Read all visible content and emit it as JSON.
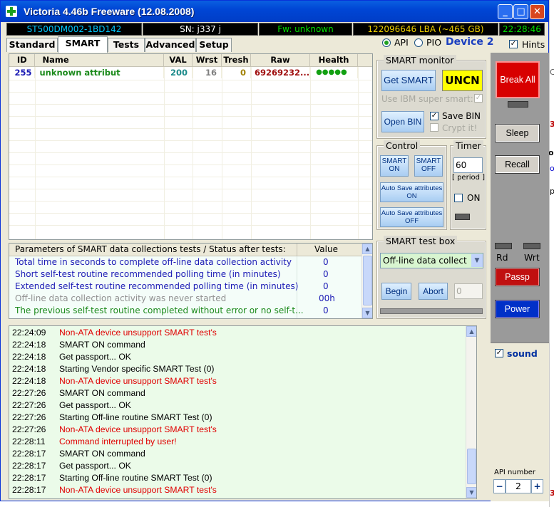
{
  "window": {
    "title": "Victoria 4.46b Freeware (12.08.2008)"
  },
  "status_bar": {
    "model": "ST500DM002-1BD142",
    "serial": "SN: j337         j",
    "firmware": "Fw: unknown",
    "capacity": "122096646 LBA (~465 GB)",
    "clock": "22:28:46"
  },
  "tabs": [
    "Standard",
    "SMART",
    "Tests",
    "Advanced",
    "Setup"
  ],
  "mode": {
    "api_label": "API",
    "pio_label": "PIO",
    "device_label": "Device 2",
    "hints_label": "Hints"
  },
  "smart_table": {
    "headers": [
      "ID",
      "Name",
      "VAL",
      "Wrst",
      "Tresh",
      "Raw",
      "Health"
    ],
    "rows": [
      {
        "id": "255",
        "name": "unknown attribut",
        "val": "200",
        "wrst": "16",
        "tresh": "0",
        "raw": "69269232...",
        "health": "●●●●●"
      }
    ]
  },
  "smart_monitor": {
    "label": "SMART monitor",
    "get_smart": "Get SMART",
    "status": "UNCN",
    "ibm_label": "Use IBM super smart:",
    "open_bin": "Open BIN",
    "save_bin": "Save BIN",
    "crypt": "Crypt it!"
  },
  "control": {
    "label": "Control",
    "smart_on": "SMART ON",
    "smart_off": "SMART OFF",
    "autosave_on": "Auto Save attributes ON",
    "autosave_off": "Auto Save attributes OFF"
  },
  "timer": {
    "label": "Timer",
    "value": "60",
    "period": "[ period ]",
    "on_label": "ON"
  },
  "params": {
    "header": "Parameters of SMART data collections tests / Status after tests:",
    "value_header": "Value",
    "rows": [
      {
        "text": "Total time in seconds to complete off-line data collection activity",
        "value": "0",
        "color": "#1b1bb5"
      },
      {
        "text": "Short self-test routine recommended polling time (in minutes)",
        "value": "0",
        "color": "#1b1bb5"
      },
      {
        "text": "Extended self-test routine recommended polling time (in minutes)",
        "value": "0",
        "color": "#1b1bb5"
      },
      {
        "text": "Off-line data collection activity was never started",
        "value": "00h",
        "color": "#909090"
      },
      {
        "text": "The previous self-test routine completed without error or no self-t...",
        "value": "0",
        "color": "#1b8a1b"
      }
    ]
  },
  "smart_test_box": {
    "label": "SMART test box",
    "selected": "Off-line data collect",
    "begin": "Begin",
    "abort": "Abort",
    "field": "0"
  },
  "sidebar": {
    "break_all": "Break All",
    "sleep": "Sleep",
    "recall": "Recall",
    "rd": "Rd",
    "wrt": "Wrt",
    "passp": "Passp",
    "power": "Power",
    "sound": "sound",
    "api_number_label": "API number",
    "api_number": "2",
    "minus": "−",
    "plus": "+"
  },
  "log": [
    {
      "time": "22:24:09",
      "msg": "Non-ATA device unsupport SMART test's",
      "color": "#e00000"
    },
    {
      "time": "22:24:18",
      "msg": "SMART ON command",
      "color": "#000000"
    },
    {
      "time": "22:24:18",
      "msg": "Get passport... OK",
      "color": "#000000"
    },
    {
      "time": "22:24:18",
      "msg": "Starting Vendor specific SMART Test (0)",
      "color": "#000000"
    },
    {
      "time": "22:24:18",
      "msg": "Non-ATA device unsupport SMART test's",
      "color": "#e00000"
    },
    {
      "time": "22:27:26",
      "msg": "SMART ON command",
      "color": "#000000"
    },
    {
      "time": "22:27:26",
      "msg": "Get passport... OK",
      "color": "#000000"
    },
    {
      "time": "22:27:26",
      "msg": "Starting Off-line routine SMART Test (0)",
      "color": "#000000"
    },
    {
      "time": "22:27:26",
      "msg": "Non-ATA device unsupport SMART test's",
      "color": "#e00000"
    },
    {
      "time": "22:28:11",
      "msg": "Command interrupted by user!",
      "color": "#e00000"
    },
    {
      "time": "22:28:17",
      "msg": "SMART ON command",
      "color": "#000000"
    },
    {
      "time": "22:28:17",
      "msg": "Get passport... OK",
      "color": "#000000"
    },
    {
      "time": "22:28:17",
      "msg": "Starting Off-line routine SMART Test (0)",
      "color": "#000000"
    },
    {
      "time": "22:28:17",
      "msg": "Non-ATA device unsupport SMART test's",
      "color": "#e00000"
    }
  ],
  "background_fragments": [
    "Cr",
    "3",
    "ol!",
    "o",
    "pt",
    "3"
  ]
}
